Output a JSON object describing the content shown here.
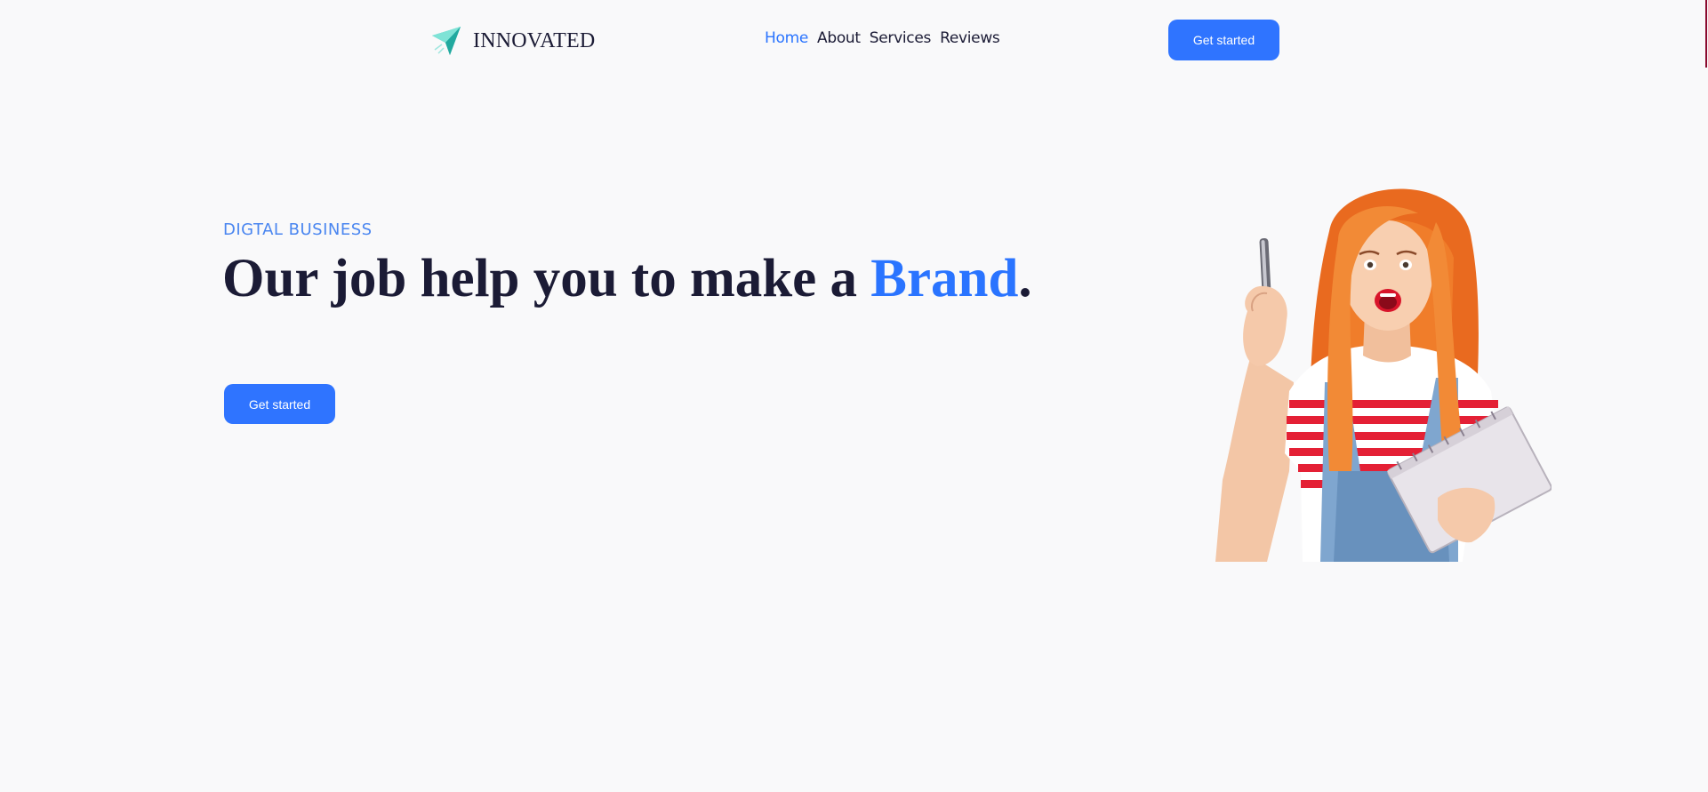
{
  "header": {
    "logo_text": "INNOVATED",
    "logo_icon": "paper-plane-icon",
    "nav": [
      {
        "label": "Home",
        "active": true
      },
      {
        "label": "About",
        "active": false
      },
      {
        "label": "Services",
        "active": false
      },
      {
        "label": "Reviews",
        "active": false
      }
    ],
    "cta_label": "Get started"
  },
  "hero": {
    "eyebrow": "DIGTAL BUSINESS",
    "headline_prefix": "Our job help you to make a ",
    "headline_accent": "Brand",
    "headline_suffix": ".",
    "cta_label": "Get started",
    "image": "woman-with-pen-and-notebook"
  },
  "colors": {
    "accent": "#2f74ff",
    "eyebrow": "#4a86f0",
    "text": "#1b1b35",
    "background": "#f9f9fa"
  }
}
